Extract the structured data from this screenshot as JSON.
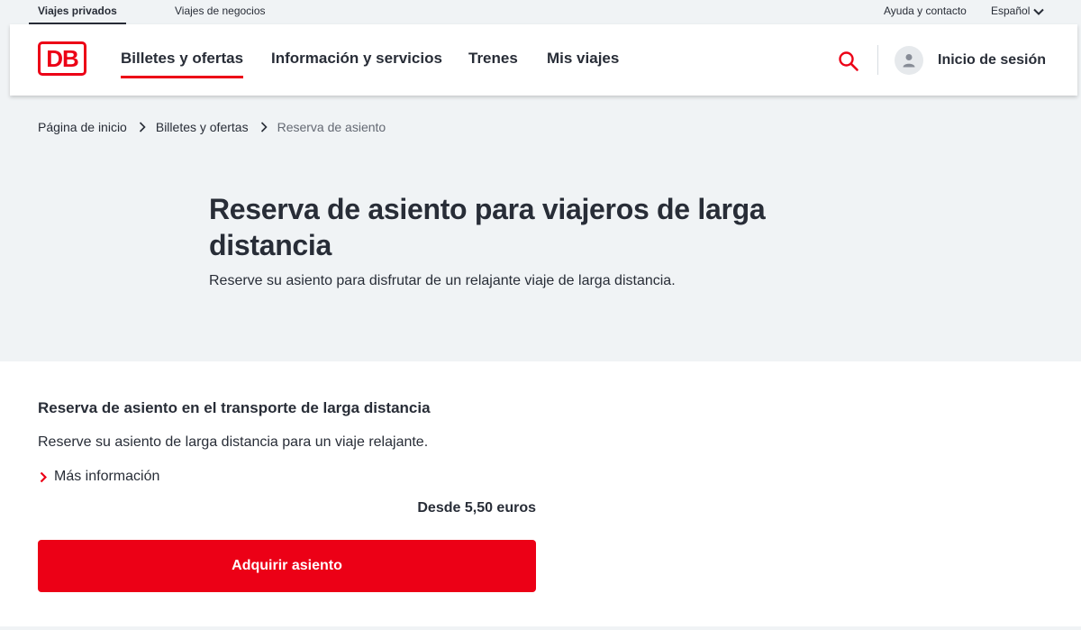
{
  "topbar": {
    "tab_private": "Viajes privados",
    "tab_business": "Viajes de negocios",
    "help": "Ayuda y contacto",
    "language": "Español"
  },
  "header": {
    "logo_text": "DB",
    "nav": [
      "Billetes y ofertas",
      "Información y servicios",
      "Trenes",
      "Mis viajes"
    ],
    "active_nav": "Billetes y ofertas",
    "login": "Inicio de sesión"
  },
  "breadcrumb": [
    "Página de inicio",
    "Billetes y ofertas",
    "Reserva de asiento"
  ],
  "hero": {
    "title": "Reserva de asiento para viajeros de larga distancia",
    "subtitle": "Reserve su asiento para disfrutar de un relajante viaje de larga distancia."
  },
  "card": {
    "title": "Reserva de asiento en el transporte de larga distancia",
    "text": "Reserve su asiento de larga distancia para un viaje relajante.",
    "more_link": "Más información",
    "price": "Desde 5,50 euros",
    "button": "Adquirir asiento"
  },
  "colors": {
    "brand_red": "#ec0016",
    "text": "#282d37",
    "background_grey": "#f0f3f5"
  },
  "icons": [
    "db-logo",
    "chevron-down-icon",
    "search-icon",
    "user-icon",
    "chevron-right-icon"
  ]
}
